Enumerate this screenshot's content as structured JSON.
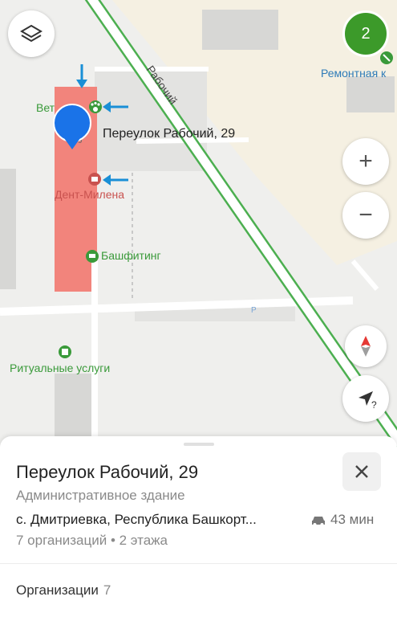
{
  "map": {
    "street_label": "Рабочий",
    "poi_vet": "Вет",
    "poi_dent": "Дент-Милена",
    "poi_bash": "Башфитинг",
    "poi_ritual": "Ритуальные услуги",
    "poi_repair": "Ремонтная к",
    "address_label": "Переулок Рабочий, 29",
    "house_number": "9",
    "parking_letter": "P",
    "colors": {
      "accent_blue": "#1a73e8",
      "poi_green": "#3a9a3a",
      "poi_red": "#c9524f",
      "road_green": "#4caf50"
    }
  },
  "controls": {
    "layers_icon": "layers-icon",
    "badge_count": "2",
    "zoom_in": "+",
    "zoom_out": "−",
    "compass_icon": "compass-icon",
    "locate_icon": "locate-icon",
    "locate_q": "?"
  },
  "sheet": {
    "title": "Переулок Рабочий, 29",
    "subtitle": "Административное здание",
    "address": "с. Дмитриевка, Республика Башкорт...",
    "travel_time": "43 мин",
    "orgs_info": "7 организаций • 2 этажа",
    "orgs_section_label": "Организации",
    "orgs_section_count": "7",
    "close_icon": "close-icon"
  }
}
